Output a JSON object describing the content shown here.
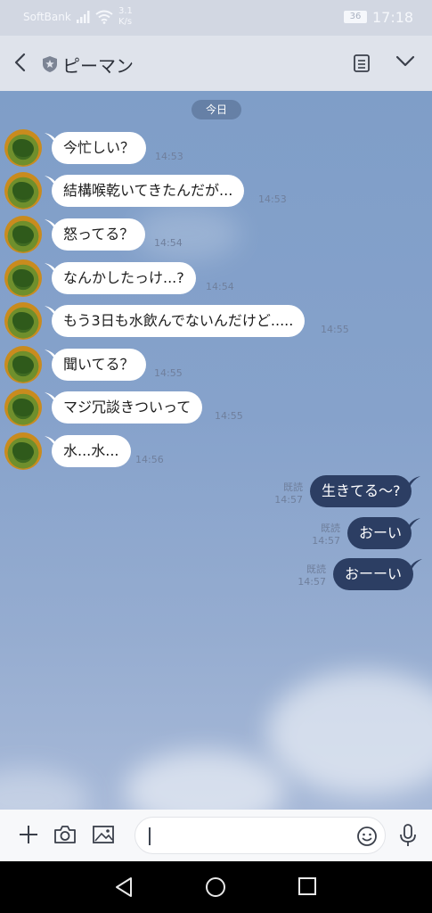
{
  "status_bar": {
    "carrier": "SoftBank",
    "speed_value": "3.1",
    "speed_unit": "K/s",
    "battery": "36",
    "time": "17:18"
  },
  "header": {
    "title": "ピーマン"
  },
  "chat": {
    "date_label": "今日",
    "incoming": [
      {
        "text": "今忙しい？",
        "time": "14:53"
      },
      {
        "text": "結構喉乾いてきたんだが...",
        "time": "14:53"
      },
      {
        "text": "怒ってる？",
        "time": "14:54"
      },
      {
        "text": "なんかしたっけ...?",
        "time": "14:54"
      },
      {
        "text": "もう3日も水飲んでないんだけど.....",
        "time": "14:55"
      },
      {
        "text": "聞いてる？",
        "time": "14:55"
      },
      {
        "text": "マジ冗談きついって",
        "time": "14:55"
      },
      {
        "text": "水...水...",
        "time": "14:56"
      }
    ],
    "outgoing": [
      {
        "text": "生きてる〜?",
        "read": "既読",
        "time": "14:57"
      },
      {
        "text": "おーい",
        "read": "既読",
        "time": "14:57"
      },
      {
        "text": "おーーい",
        "read": "既読",
        "time": "14:57"
      }
    ]
  },
  "colors": {
    "outgoing_bubble": "#2c3e63",
    "incoming_bubble": "#ffffff",
    "chat_background": "#86a2cb"
  },
  "icons": [
    "back-icon",
    "shield-icon",
    "notes-icon",
    "chevron-down-icon",
    "plus-icon",
    "camera-icon",
    "image-icon",
    "emoji-icon",
    "mic-icon",
    "nav-back-icon",
    "nav-home-icon",
    "nav-recents-icon"
  ]
}
